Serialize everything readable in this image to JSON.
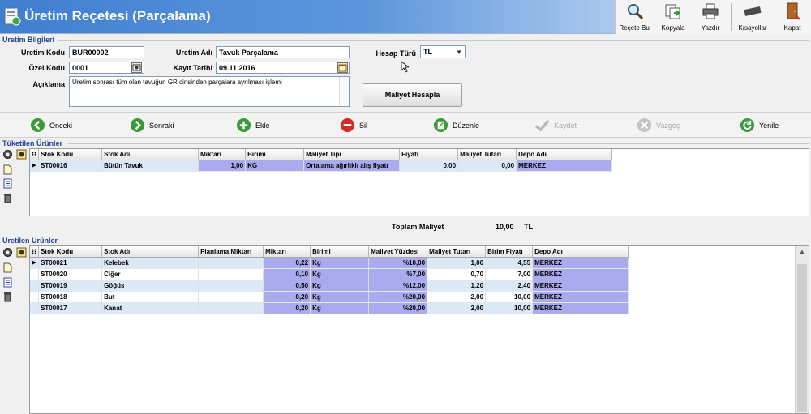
{
  "window": {
    "title": "Üretim Reçetesi (Parçalama)"
  },
  "toolbar": {
    "items": [
      {
        "label": "Reçete Bul",
        "icon": "search-icon"
      },
      {
        "label": "Kopyala",
        "icon": "copy-icon"
      },
      {
        "label": "Yazdır",
        "icon": "printer-icon"
      },
      {
        "label": "Kısayollar",
        "icon": "keyboard-icon"
      },
      {
        "label": "Kapat",
        "icon": "exit-door-icon"
      }
    ]
  },
  "info": {
    "section_title": "Üretim Bilgileri",
    "uretim_kodu_label": "Üretim Kodu",
    "uretim_kodu_value": "BUR00002",
    "ozel_kodu_label": "Özel Kodu",
    "ozel_kodu_value": "0001",
    "aciklama_label": "Açıklama",
    "aciklama_value": "Üretim sonrası tüm olan tavuğun GR cinsinden parçalara ayrılması işlemi",
    "uretim_adi_label": "Üretim Adı",
    "uretim_adi_value": "Tavuk Parçalama",
    "kayit_tarihi_label": "Kayıt Tarihi",
    "kayit_tarihi_value": "09.11.2016",
    "hesap_turu_label": "Hesap Türü",
    "hesap_turu_value": "TL",
    "maliyet_button": "Maliyet Hesapla"
  },
  "actions": [
    {
      "label": "Önceki",
      "icon": "arrow-left-icon",
      "color": "#3a9a3a",
      "enabled": true
    },
    {
      "label": "Sonraki",
      "icon": "arrow-right-icon",
      "color": "#3a9a3a",
      "enabled": true
    },
    {
      "label": "Ekle",
      "icon": "plus-icon",
      "color": "#3a9a3a",
      "enabled": true
    },
    {
      "label": "Sil",
      "icon": "minus-icon",
      "color": "#d42a2a",
      "enabled": true
    },
    {
      "label": "Düzenle",
      "icon": "edit-icon",
      "color": "#3a9a3a",
      "enabled": true
    },
    {
      "label": "Kaydet",
      "icon": "checkmark-icon",
      "color": "#b8b8b8",
      "enabled": false
    },
    {
      "label": "Vazgeç",
      "icon": "cancel-icon",
      "color": "#b8b8b8",
      "enabled": false
    },
    {
      "label": "Yenile",
      "icon": "refresh-icon",
      "color": "#3a9a3a",
      "enabled": true
    }
  ],
  "consumed": {
    "section_title": "Tüketilen Ürünler",
    "columns": [
      "Stok Kodu",
      "Stok Adı",
      "Miktarı",
      "Birimi",
      "Maliyet Tipi",
      "Fiyatı",
      "Maliyet Tutarı",
      "Depo Adı"
    ],
    "rows": [
      {
        "stok_kodu": "ST00016",
        "stok_adi": "Bütün Tavuk",
        "miktari": "1,00",
        "birimi": "KG",
        "maliyet_tipi": "Ortalama ağırlıklı alış fiyatı",
        "fiyati": "0,00",
        "maliyet_tutari": "0,00",
        "depo_adi": "MERKEZ"
      }
    ]
  },
  "total": {
    "label": "Toplam Maliyet",
    "value": "10,00",
    "currency": "TL"
  },
  "produced": {
    "section_title": "Üretilen Ürünler",
    "columns": [
      "Stok Kodu",
      "Stok Adı",
      "Planlama Miktarı",
      "Miktarı",
      "Birimi",
      "Maliyet Yüzdesi",
      "Maliyet Tutarı",
      "Birim Fiyatı",
      "Depo Adı"
    ],
    "rows": [
      {
        "stok_kodu": "ST00021",
        "stok_adi": "Kelebek",
        "planlama": "",
        "miktari": "0,22",
        "birimi": "Kg",
        "yuzde": "%10,00",
        "tutar": "1,00",
        "birim_fiyati": "4,55",
        "depo_adi": "MERKEZ"
      },
      {
        "stok_kodu": "ST00020",
        "stok_adi": "Ciğer",
        "planlama": "",
        "miktari": "0,10",
        "birimi": "Kg",
        "yuzde": "%7,00",
        "tutar": "0,70",
        "birim_fiyati": "7,00",
        "depo_adi": "MERKEZ"
      },
      {
        "stok_kodu": "ST00019",
        "stok_adi": "Göğüs",
        "planlama": "",
        "miktari": "0,50",
        "birimi": "Kg",
        "yuzde": "%12,00",
        "tutar": "1,20",
        "birim_fiyati": "2,40",
        "depo_adi": "MERKEZ"
      },
      {
        "stok_kodu": "ST00018",
        "stok_adi": "But",
        "planlama": "",
        "miktari": "0,20",
        "birimi": "Kg",
        "yuzde": "%20,00",
        "tutar": "2,00",
        "birim_fiyati": "10,00",
        "depo_adi": "MERKEZ"
      },
      {
        "stok_kodu": "ST00017",
        "stok_adi": "Kanat",
        "planlama": "",
        "miktari": "0,20",
        "birimi": "Kg",
        "yuzde": "%20,00",
        "tutar": "2,00",
        "birim_fiyati": "10,00",
        "depo_adi": "MERKEZ"
      }
    ]
  },
  "colors": {
    "title_gradient_start": "#3f7fd0",
    "highlight_cell": "#aaaaee",
    "alt_row": "#dbe8f6",
    "section_title": "#1f3f8f"
  }
}
